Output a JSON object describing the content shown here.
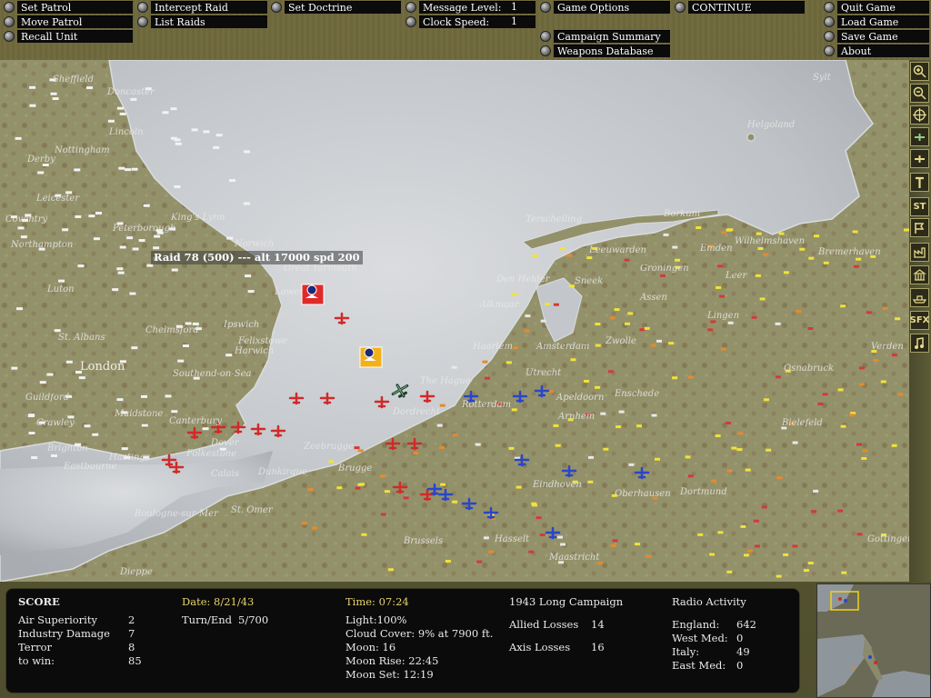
{
  "menu": {
    "set_patrol": "Set Patrol",
    "move_patrol": "Move Patrol",
    "recall_unit": "Recall Unit",
    "intercept_raid": "Intercept Raid",
    "list_raids": "List Raids",
    "set_doctrine": "Set Doctrine",
    "message_level_label": "Message Level:",
    "message_level_value": "1",
    "clock_speed_label": "Clock Speed:",
    "clock_speed_value": "1",
    "game_options": "Game Options",
    "continue": "CONTINUE",
    "campaign_summary": "Campaign Summary",
    "weapons_database": "Weapons Database",
    "quit_game": "Quit Game",
    "load_game": "Load Game",
    "save_game": "Save Game",
    "about": "About"
  },
  "tools": [
    "zoom-in",
    "zoom-out",
    "target",
    "airfield-green",
    "airfield-yellow",
    "hammer",
    "ST",
    "flag",
    "factory",
    "building",
    "ship",
    "SFX",
    "music-note"
  ],
  "tool_labels": {
    "st": "ST",
    "sfx": "SFX"
  },
  "raid": {
    "label": "Raid 78 (500) --- alt 17000 spd 200"
  },
  "places": {
    "sheffield": "Sheffield",
    "doncaster": "Doncaster",
    "lincoln": "Lincoln",
    "nottingham": "Nottingham",
    "derby": "Derby",
    "leicester": "Leicester",
    "coventry": "Coventry",
    "northampton": "Northampton",
    "peterborough": "Peterborough",
    "kings_lynn": "King's Lynn",
    "norwich": "Norwich",
    "great_yarmouth": "Great Yarmouth",
    "lowestoft": "Lowestoft",
    "luton": "Luton",
    "ipswich": "Ipswich",
    "felixstowe": "Felixstowe",
    "harwich": "Harwich",
    "chelmsford": "Chelmsford",
    "st_albans": "St. Albans",
    "london": "London",
    "southend": "Southend-on-Sea",
    "guildford": "Guildford",
    "crawley": "Crawley",
    "maidstone": "Maidstone",
    "canterbury": "Canterbury",
    "dover": "Dover",
    "folkestone": "Folkestone",
    "hastings": "Hastings",
    "eastbourne": "Eastbourne",
    "brighton": "Brighton",
    "calais": "Calais",
    "dunkirk": "Dunkirque",
    "boulogne": "Boulogne-sur-Mer",
    "st_omer": "St. Omer",
    "dieppe": "Dieppe",
    "zeebrugge": "Zeebrugge",
    "bruges": "Brugge",
    "helgoland": "Helgoland",
    "sylt": "Sylt",
    "terschelling": "Terschelling",
    "borkum": "Borkum",
    "den_helder": "Den Helder",
    "leeuwarden": "Leeuwarden",
    "groningen": "Groningen",
    "wilhelmshaven": "Wilhelmshaven",
    "bremerhaven": "Bremerhaven",
    "emden": "Emden",
    "sneek": "Sneek",
    "assen": "Assen",
    "leer": "Leer",
    "alkmaar": "Alkmaar",
    "amsterdam": "Amsterdam",
    "haarlem": "Haarlem",
    "the_hague": "The Hague",
    "rotterdam": "Rotterdam",
    "dordrecht": "Dordrecht",
    "utrecht": "Utrecht",
    "apeldoorn": "Apeldoorn",
    "arnhem": "Arnhem",
    "zwolle": "Zwolle",
    "enschede": "Enschede",
    "lingen": "Lingen",
    "osnabruck": "Osnabruck",
    "verden": "Verden",
    "bielefeld": "Bielefeld",
    "eindhoven": "Eindhoven",
    "oberhausen": "Oberhausen",
    "dortmund": "Dortmund",
    "brussels": "Brussels",
    "hasselt": "Hasselt",
    "maastricht": "Maastricht",
    "gottingen": "Gottingen"
  },
  "score": {
    "title": "SCORE",
    "rows": [
      {
        "label": "Air Superiority",
        "value": "2"
      },
      {
        "label": "Industry Damage",
        "value": "7"
      },
      {
        "label": "Terror",
        "value": "8"
      },
      {
        "label": "to win:",
        "value": "85"
      }
    ]
  },
  "date": {
    "label": "Date: 8/21/43",
    "turn_label": "Turn/End",
    "turn_value": "5/700"
  },
  "conditions": {
    "time": "Time: 07:24",
    "light": "Light:100%",
    "cloud": "Cloud Cover: 9% at 7900 ft.",
    "moon": "Moon: 16",
    "moon_rise": "Moon Rise: 22:45",
    "moon_set": "Moon Set: 12:19"
  },
  "campaign": {
    "title": "1943 Long Campaign",
    "allied_label": "Allied Losses",
    "allied_value": "14",
    "axis_label": "Axis Losses",
    "axis_value": "16"
  },
  "radio": {
    "title": "Radio Activity",
    "rows": [
      {
        "label": "England:",
        "value": "642"
      },
      {
        "label": "West Med:",
        "value": "0"
      },
      {
        "label": "Italy:",
        "value": "49"
      },
      {
        "label": "East Med:",
        "value": "0"
      }
    ]
  },
  "colors": {
    "sea": "#c9cdd1",
    "land": "#8f8e66",
    "allied_raid": "#d02a2a",
    "axis_unit": "#2b45c9",
    "menu_label_bg": "#0b0b0b",
    "score_accent": "#e8d26a"
  }
}
